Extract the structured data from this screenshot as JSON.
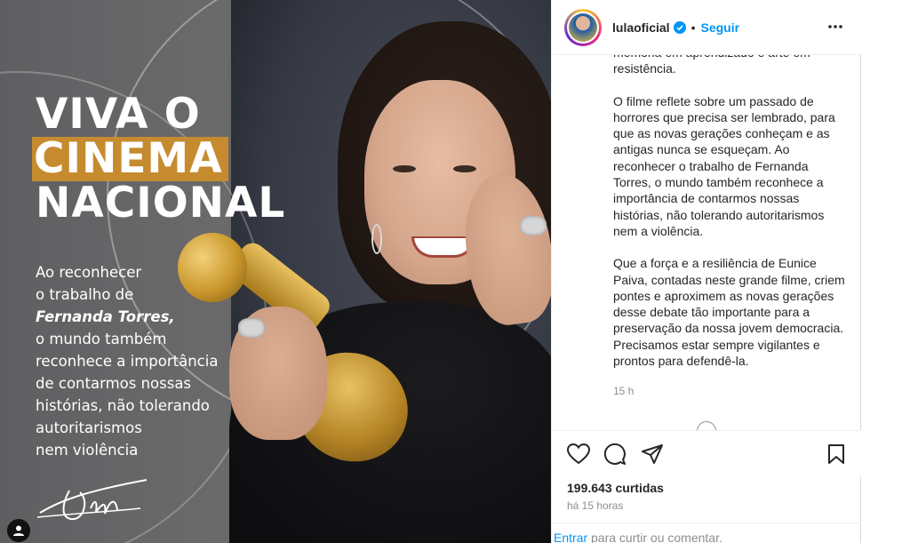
{
  "media": {
    "headline": [
      "VIVA O",
      "CINEMA",
      "NACIONAL"
    ],
    "body_lines": [
      "Ao reconhecer",
      "o trabalho de",
      "Fernanda Torres,",
      "o mundo também",
      "reconhece a importância",
      "de contarmos nossas",
      "histórias, não tolerando",
      "autoritarismos",
      "nem violência"
    ],
    "signature": "Lula",
    "accent_color": "#c68b2f",
    "icons": {
      "user_tag": "user-tag-icon"
    }
  },
  "header": {
    "username": "lulaoficial",
    "separator": "•",
    "follow_label": "Seguir",
    "verified_color": "#0095f6",
    "icons": {
      "verified": "verified-badge-icon",
      "more": "more-options-icon"
    }
  },
  "caption": {
    "cut_top": "memória em aprendizado e arte em",
    "cut_line2": "resistência.",
    "p1": "O filme reflete sobre um passado de horrores que precisa ser lembrado, para que as novas gerações conheçam e as antigas nunca se esqueçam. Ao reconhecer o trabalho de Fernanda Torres, o mundo também reconhece a importância de contarmos nossas histórias, não tolerando autoritarismos nem a violência.",
    "p2": "Que a força e a resiliência de Eunice Paiva, contadas neste grande filme, criem pontes e aproximem as novas gerações desse debate tão importante para a preservação da nossa jovem democracia. Precisamos estar sempre vigilantes e prontos para defendê-la.",
    "time": "15 h"
  },
  "actions": {
    "icons": [
      "heart-icon",
      "comment-icon",
      "share-icon",
      "bookmark-icon"
    ],
    "likes": "199.643 curtidas",
    "ago": "há 15 horas"
  },
  "comment": {
    "login_label": "Entrar",
    "rest": " para curtir ou comentar."
  }
}
